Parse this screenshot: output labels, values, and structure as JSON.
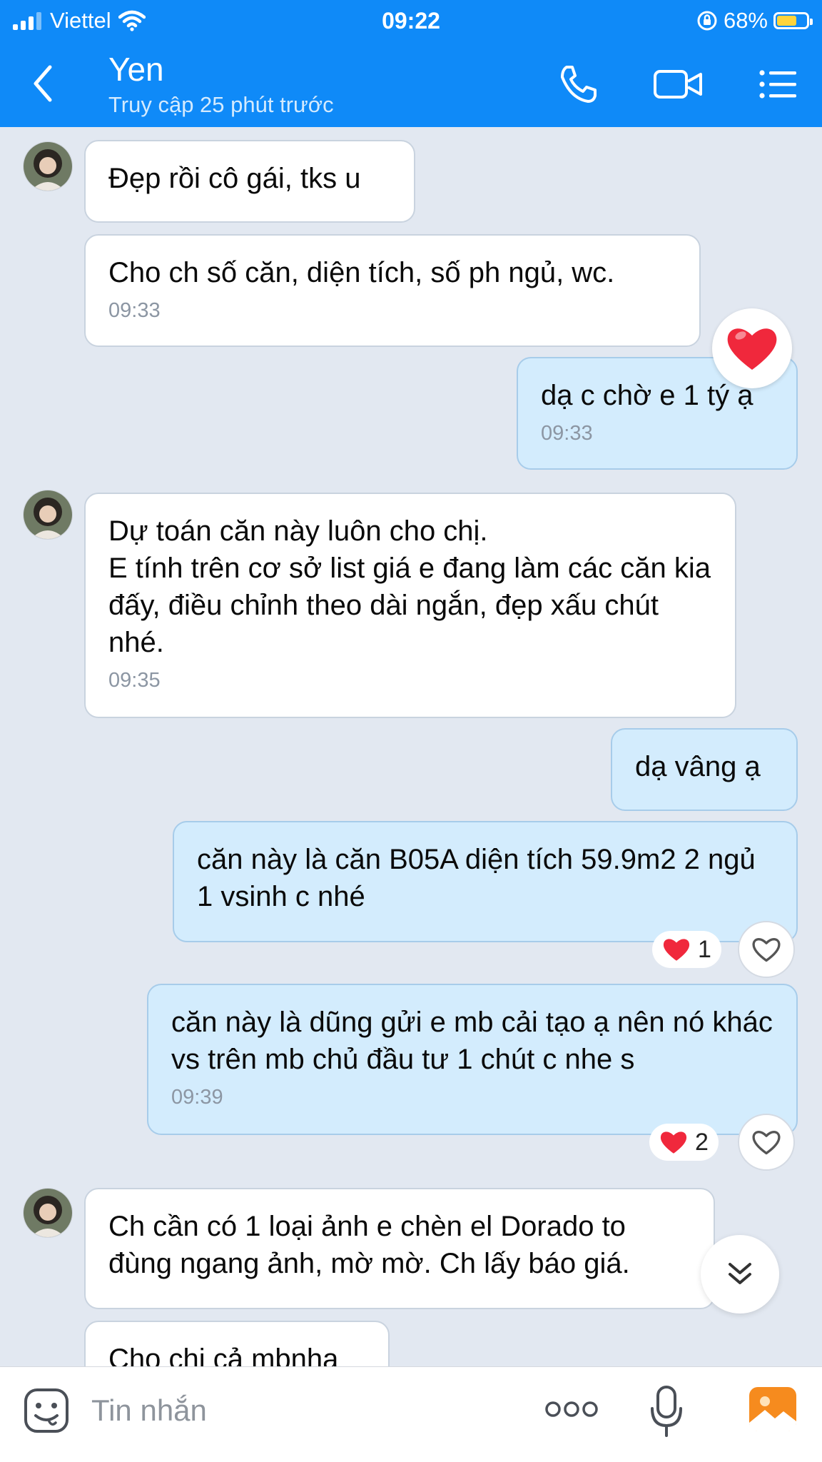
{
  "status_bar": {
    "carrier": "Viettel",
    "time": "09:22",
    "battery_percent": "68%",
    "battery_level": 0.68,
    "icons": [
      "signal-icon",
      "wifi-icon",
      "orientation-lock-icon",
      "battery-icon"
    ]
  },
  "header": {
    "contact_name": "Yen",
    "contact_status": "Truy cập 25 phút trước",
    "icons": [
      "back-icon",
      "phone-icon",
      "video-call-icon",
      "menu-icon"
    ],
    "accent_color": "#0f8af8"
  },
  "messages": [
    {
      "side": "in",
      "text": "Đẹp rồi cô gái, tks u",
      "time": ""
    },
    {
      "side": "in",
      "text": "Cho ch số căn, diện tích, số ph ngủ, wc.",
      "time": "09:33"
    },
    {
      "side": "out",
      "text": "dạ c chờ e 1 tý ạ",
      "time": "09:33",
      "reaction": "❤️"
    },
    {
      "side": "in",
      "text": "Dự toán căn này luôn cho chị.\nE tính trên cơ sở list giá e đang làm các căn kia đấy, điều chỉnh theo dài ngắn, đẹp xấu chút nhé.",
      "time": "09:35"
    },
    {
      "side": "out",
      "text": "dạ vâng ạ",
      "time": ""
    },
    {
      "side": "out",
      "text": "căn này là căn B05A diện tích 59.9m2 2 ngủ 1 vsinh c nhé",
      "time": "",
      "reaction_count": "1"
    },
    {
      "side": "out",
      "text": "căn này là dũng gửi e mb cải tạo ạ nên nó khác vs trên mb chủ đầu tư 1 chút c nhe s",
      "time": "09:39",
      "reaction_count": "2"
    },
    {
      "side": "in",
      "text": "Ch cần có 1 loại ảnh e chèn el Dorado to đùng ngang ảnh, mờ mờ. Ch lấy báo giá.",
      "time": ""
    },
    {
      "side": "in",
      "text": "Cho chị cả mbnha",
      "time": ""
    }
  ],
  "input_bar": {
    "placeholder": "Tin nhắn",
    "icons": [
      "sticker-icon",
      "more-icon",
      "microphone-icon",
      "gallery-icon"
    ]
  },
  "colors": {
    "background": "#e2e8f1",
    "incoming_bubble": "#ffffff",
    "outgoing_bubble": "#d3ecfd",
    "reaction_heart": "#f0283c",
    "gallery_icon": "#f68b1e"
  }
}
